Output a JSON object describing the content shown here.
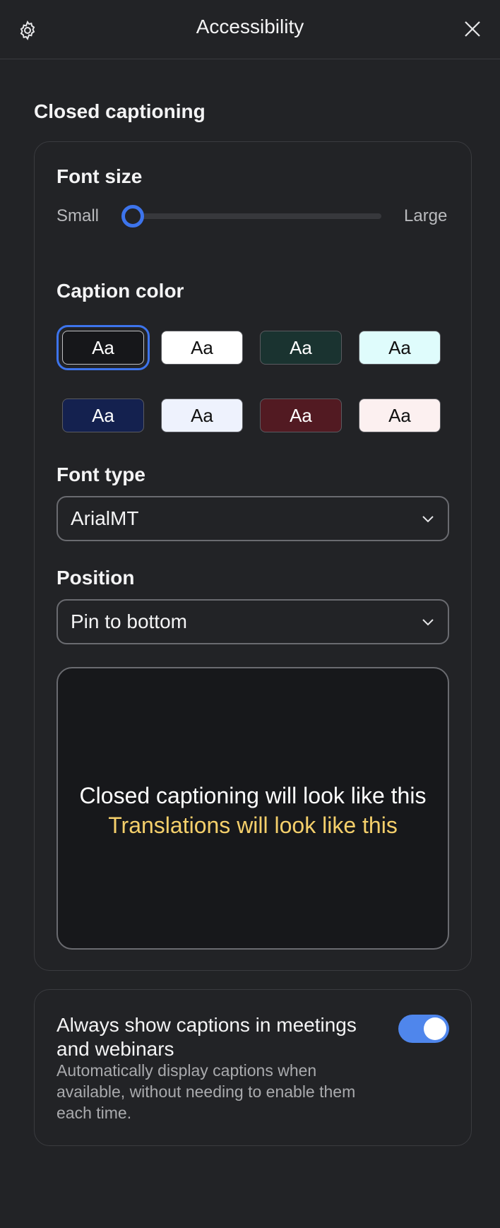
{
  "header": {
    "title": "Accessibility",
    "settings_icon": "gear-icon",
    "close_icon": "close-icon"
  },
  "closed_captioning": {
    "section_title": "Closed captioning",
    "font_size": {
      "label": "Font size",
      "min_label": "Small",
      "max_label": "Large",
      "value_fraction": 0
    },
    "caption_color": {
      "label": "Caption color",
      "swatches": [
        {
          "text": "Aa",
          "bg": "#16171a",
          "fg": "#ffffff",
          "selected": true
        },
        {
          "text": "Aa",
          "bg": "#ffffff",
          "fg": "#111111",
          "selected": false
        },
        {
          "text": "Aa",
          "bg": "#1a3330",
          "fg": "#ffffff",
          "selected": false
        },
        {
          "text": "Aa",
          "bg": "#dffcfc",
          "fg": "#111111",
          "selected": false
        },
        {
          "text": "Aa",
          "bg": "#14214f",
          "fg": "#ffffff",
          "selected": false
        },
        {
          "text": "Aa",
          "bg": "#eef2fd",
          "fg": "#111111",
          "selected": false
        },
        {
          "text": "Aa",
          "bg": "#521a22",
          "fg": "#ffffff",
          "selected": false
        },
        {
          "text": "Aa",
          "bg": "#fcf0f0",
          "fg": "#111111",
          "selected": false
        }
      ]
    },
    "font_type": {
      "label": "Font type",
      "value": "ArialMT"
    },
    "position": {
      "label": "Position",
      "value": "Pin to bottom"
    },
    "preview": {
      "caption_text": "Closed captioning will look like this",
      "translation_text": "Translations will look like this",
      "caption_color": "#ffffff",
      "translation_color": "#f4cf6b"
    }
  },
  "always_show": {
    "title": "Always show captions in meetings and webinars",
    "description": "Automatically display captions when available, without needing to enable them each time.",
    "enabled": true
  },
  "colors": {
    "accent": "#3d74ec",
    "toggle_on": "#4f86ec",
    "background": "#222326"
  }
}
